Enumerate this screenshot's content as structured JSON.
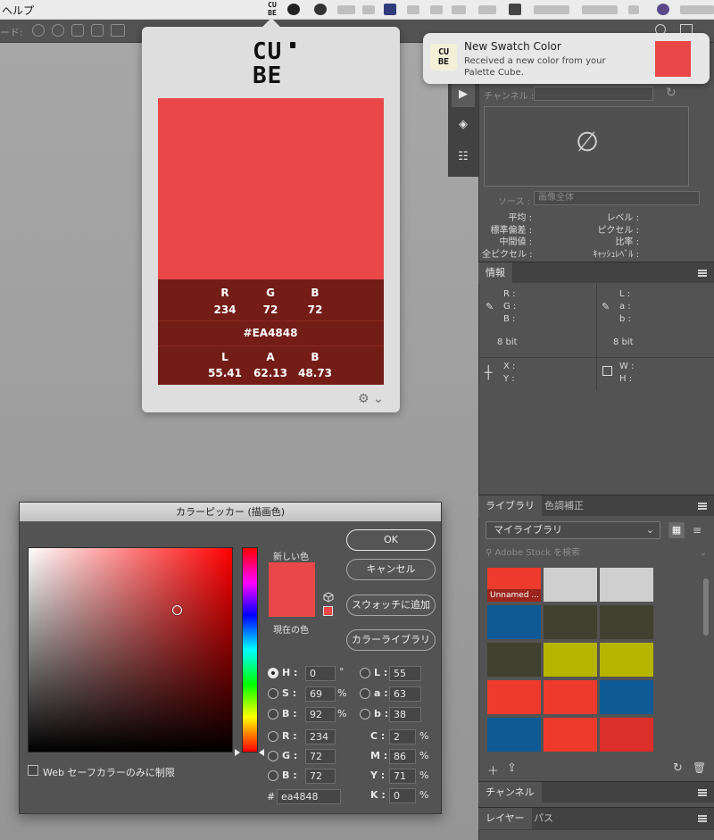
{
  "menubar": {
    "help": "ヘルプ",
    "cube_top": "CU",
    "cube_bottom": "BE"
  },
  "optbar": {
    "label": "ード:"
  },
  "cube_popover": {
    "logo_top": "CU",
    "logo_bottom": "BE",
    "swatch_color": "#EA4848",
    "rgb_labels": [
      "R",
      "G",
      "B"
    ],
    "rgb_values": [
      "234",
      "72",
      "72"
    ],
    "hex": "#EA4848",
    "lab_labels": [
      "L",
      "A",
      "B"
    ],
    "lab_values": [
      "55.41",
      "62.13",
      "48.73"
    ],
    "settings_icon": "⚙︎ ⌄"
  },
  "notification": {
    "title": "New Swatch Color",
    "body": "Received a new color from your Palette Cube.",
    "swatch_color": "#EA4848",
    "icon_top": "CU",
    "icon_bottom": "BE"
  },
  "histogram": {
    "channel_label": "チャンネル :",
    "no_data_symbol": "∅",
    "source_label": "ソース :",
    "source_value": "画像全体",
    "stats_left": [
      "平均 :",
      "標準偏差 :",
      "中間値 :",
      "全ピクセル :"
    ],
    "stats_right": [
      "レベル :",
      "ピクセル :",
      "比率 :",
      "ｷｬｯｼｭﾚﾍﾞﾙ :"
    ]
  },
  "info_panel": {
    "tab": "情報",
    "left_channels": [
      "R :",
      "G :",
      "B :"
    ],
    "right_channels": [
      "L :",
      "a :",
      "b :"
    ],
    "bit_left": "8 bit",
    "bit_right": "8 bit",
    "xy": [
      "X :",
      "Y :"
    ],
    "wh": [
      "W :",
      "H :"
    ]
  },
  "library_panel": {
    "tabs": [
      "ライブラリ",
      "色調補正"
    ],
    "selected_library": "マイライブラリ",
    "search_placeholder": "Adobe Stock を検索",
    "first_swatch_label": "Unnamed ...",
    "swatches": [
      "#ee3a2c",
      "#cfcfcf",
      "#cfcfcf",
      "#0f5a94",
      "#41412f",
      "#41412f",
      "#41412f",
      "#b7b400",
      "#b7b400",
      "#ee3a2c",
      "#ee3a2c",
      "#0f5a94",
      "#0f5a94",
      "#ee3a2c",
      "#db2f2a"
    ]
  },
  "channels_panel": {
    "tab": "チャンネル"
  },
  "layers_panel": {
    "tabs": [
      "レイヤー",
      "パス"
    ]
  },
  "color_picker": {
    "title": "カラーピッカー (描画色)",
    "new_label": "新しい色",
    "current_label": "現在の色",
    "new_color": "#EA4848",
    "current_color": "#EA4848",
    "buttons": {
      "ok": "OK",
      "cancel": "キャンセル",
      "add_swatch": "スウォッチに追加",
      "color_libraries": "カラーライブラリ"
    },
    "hsb": [
      {
        "label": "H :",
        "value": "0",
        "unit": "°",
        "selected": true
      },
      {
        "label": "S :",
        "value": "69",
        "unit": "%",
        "selected": false
      },
      {
        "label": "B :",
        "value": "92",
        "unit": "%",
        "selected": false
      }
    ],
    "rgb": [
      {
        "label": "R :",
        "value": "234"
      },
      {
        "label": "G :",
        "value": "72"
      },
      {
        "label": "B :",
        "value": "72"
      }
    ],
    "lab": [
      {
        "label": "L :",
        "value": "55"
      },
      {
        "label": "a :",
        "value": "63"
      },
      {
        "label": "b :",
        "value": "38"
      }
    ],
    "cmyk": [
      {
        "label": "C :",
        "value": "2",
        "unit": "%"
      },
      {
        "label": "M :",
        "value": "86",
        "unit": "%"
      },
      {
        "label": "Y :",
        "value": "71",
        "unit": "%"
      },
      {
        "label": "K :",
        "value": "0",
        "unit": "%"
      }
    ],
    "hex_label": "#",
    "hex_value": "ea4848",
    "web_only_label": "Web セーフカラーのみに制限"
  }
}
